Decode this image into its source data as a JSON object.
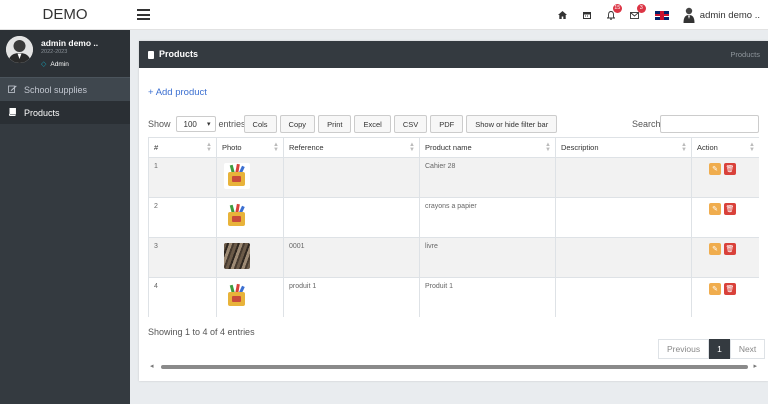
{
  "brand": "DEMO",
  "header": {
    "notifications_count": "15",
    "messages_count": "3",
    "user_name": "admin demo .."
  },
  "sidebar": {
    "profile": {
      "name": "admin demo ..",
      "year": "2022-2023",
      "role": "Admin"
    },
    "items": [
      {
        "label": "School supplies",
        "icon": "edit-icon"
      },
      {
        "label": "Products",
        "icon": "book-icon"
      }
    ]
  },
  "card": {
    "title": "Products",
    "breadcrumb": "Products",
    "add_label": "Add product"
  },
  "table_controls": {
    "show_label": "Show",
    "length_value": "100",
    "entries_label": "entries",
    "buttons": [
      "Cols",
      "Copy",
      "Print",
      "Excel",
      "CSV",
      "PDF",
      "Show or hide filter bar"
    ],
    "search_label": "Search:"
  },
  "table": {
    "columns": [
      "#",
      "Photo",
      "Reference",
      "Product name",
      "Description",
      "Action"
    ],
    "rows": [
      {
        "num": "1",
        "photo": "kit",
        "reference": "",
        "name": "Cahier 28",
        "description": ""
      },
      {
        "num": "2",
        "photo": "kit",
        "reference": "",
        "name": "crayons a papier",
        "description": ""
      },
      {
        "num": "3",
        "photo": "books",
        "reference": "0001",
        "name": "livre",
        "description": ""
      },
      {
        "num": "4",
        "photo": "kit",
        "reference": "produit 1",
        "name": "Produit 1",
        "description": ""
      }
    ]
  },
  "footer": {
    "info": "Showing 1 to 4 of 4 entries",
    "previous": "Previous",
    "page": "1",
    "next": "Next"
  },
  "colors": {
    "sidebar_bg": "#343a40",
    "edit_button": "#f0ad4e",
    "delete_button": "#d9413a",
    "link": "#3b6fd1",
    "badge": "#dc3545"
  }
}
